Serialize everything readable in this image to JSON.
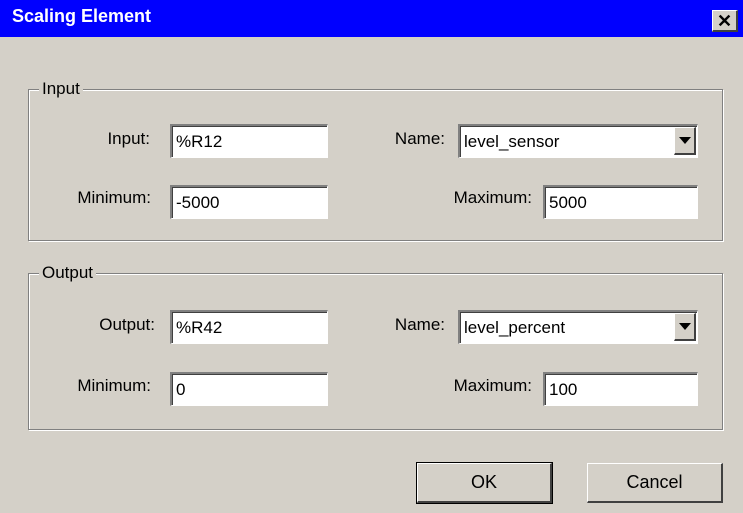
{
  "window": {
    "title": "Scaling Element",
    "close_glyph": "✕"
  },
  "input_group": {
    "label": "Input",
    "input_label": "Input:",
    "input_value": "%R12",
    "name_label": "Name:",
    "name_value": "level_sensor",
    "minimum_label": "Minimum:",
    "minimum_value": "-5000",
    "maximum_label": "Maximum:",
    "maximum_value": "5000"
  },
  "output_group": {
    "label": "Output",
    "output_label": "Output:",
    "output_value": "%R42",
    "name_label": "Name:",
    "name_value": "level_percent",
    "minimum_label": "Minimum:",
    "minimum_value": "0",
    "maximum_label": "Maximum:",
    "maximum_value": "100"
  },
  "buttons": {
    "ok": "OK",
    "cancel": "Cancel"
  },
  "colors": {
    "titlebar": "#0000ff",
    "face": "#d4d0c8"
  },
  "icons": {
    "close": "close-icon",
    "dropdown": "chevron-down-icon"
  }
}
